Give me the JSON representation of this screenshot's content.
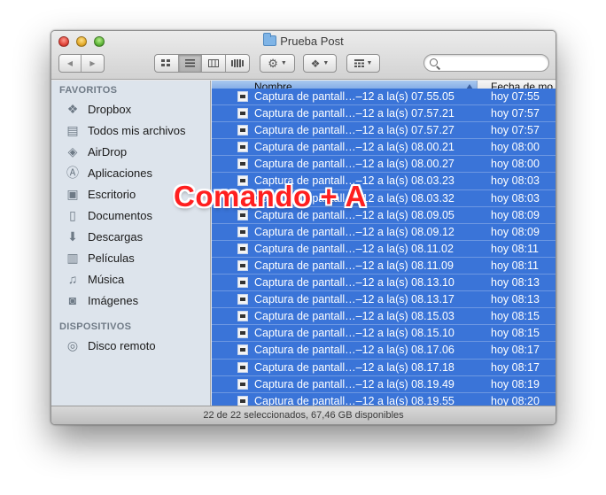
{
  "window": {
    "title": "Prueba Post"
  },
  "toolbar": {
    "back_icon": "◀",
    "forward_icon": "▶",
    "view_modes": [
      "icon-view",
      "list-view",
      "column-view",
      "coverflow-view"
    ]
  },
  "sidebar": {
    "favorites_header": "FAVORITOS",
    "favorites": [
      {
        "label": "Dropbox",
        "icon": "dropbox-icon"
      },
      {
        "label": "Todos mis archivos",
        "icon": "all-files-icon"
      },
      {
        "label": "AirDrop",
        "icon": "airdrop-icon"
      },
      {
        "label": "Aplicaciones",
        "icon": "applications-icon"
      },
      {
        "label": "Escritorio",
        "icon": "desktop-icon"
      },
      {
        "label": "Documentos",
        "icon": "documents-icon"
      },
      {
        "label": "Descargas",
        "icon": "downloads-icon"
      },
      {
        "label": "Películas",
        "icon": "movies-icon"
      },
      {
        "label": "Música",
        "icon": "music-icon"
      },
      {
        "label": "Imágenes",
        "icon": "pictures-icon"
      }
    ],
    "devices_header": "DISPOSITIVOS",
    "devices": [
      {
        "label": "Disco remoto",
        "icon": "remote-disc-icon"
      }
    ]
  },
  "list": {
    "columns": {
      "name": "Nombre",
      "date": "Fecha de mo"
    },
    "rows": [
      {
        "name": "Captura de pantall…–12 a la(s) 07.55.05",
        "date": "hoy 07:55"
      },
      {
        "name": "Captura de pantall…–12 a la(s) 07.57.21",
        "date": "hoy 07:57"
      },
      {
        "name": "Captura de pantall…–12 a la(s) 07.57.27",
        "date": "hoy 07:57"
      },
      {
        "name": "Captura de pantall…–12 a la(s) 08.00.21",
        "date": "hoy 08:00"
      },
      {
        "name": "Captura de pantall…–12 a la(s) 08.00.27",
        "date": "hoy 08:00"
      },
      {
        "name": "Captura de pantall…–12 a la(s) 08.03.23",
        "date": "hoy 08:03"
      },
      {
        "name": "Captura de pantall…–12 a la(s) 08.03.32",
        "date": "hoy 08:03"
      },
      {
        "name": "Captura de pantall…–12 a la(s) 08.09.05",
        "date": "hoy 08:09"
      },
      {
        "name": "Captura de pantall…–12 a la(s) 08.09.12",
        "date": "hoy 08:09"
      },
      {
        "name": "Captura de pantall…–12 a la(s) 08.11.02",
        "date": "hoy 08:11"
      },
      {
        "name": "Captura de pantall…–12 a la(s) 08.11.09",
        "date": "hoy 08:11"
      },
      {
        "name": "Captura de pantall…–12 a la(s) 08.13.10",
        "date": "hoy 08:13"
      },
      {
        "name": "Captura de pantall…–12 a la(s) 08.13.17",
        "date": "hoy 08:13"
      },
      {
        "name": "Captura de pantall…–12 a la(s) 08.15.03",
        "date": "hoy 08:15"
      },
      {
        "name": "Captura de pantall…–12 a la(s) 08.15.10",
        "date": "hoy 08:15"
      },
      {
        "name": "Captura de pantall…–12 a la(s) 08.17.06",
        "date": "hoy 08:17"
      },
      {
        "name": "Captura de pantall…–12 a la(s) 08.17.18",
        "date": "hoy 08:17"
      },
      {
        "name": "Captura de pantall…–12 a la(s) 08.19.49",
        "date": "hoy 08:19"
      },
      {
        "name": "Captura de pantall…–12 a la(s) 08.19.55",
        "date": "hoy 08:20"
      }
    ]
  },
  "overlay": {
    "text": "Comando + A"
  },
  "status": {
    "text": "22 de 22 seleccionados, 67,46 GB disponibles"
  },
  "colors": {
    "selection": "#3a74d8",
    "sidebar_bg": "#dde4ec",
    "overlay_text": "#ff1f1f"
  }
}
